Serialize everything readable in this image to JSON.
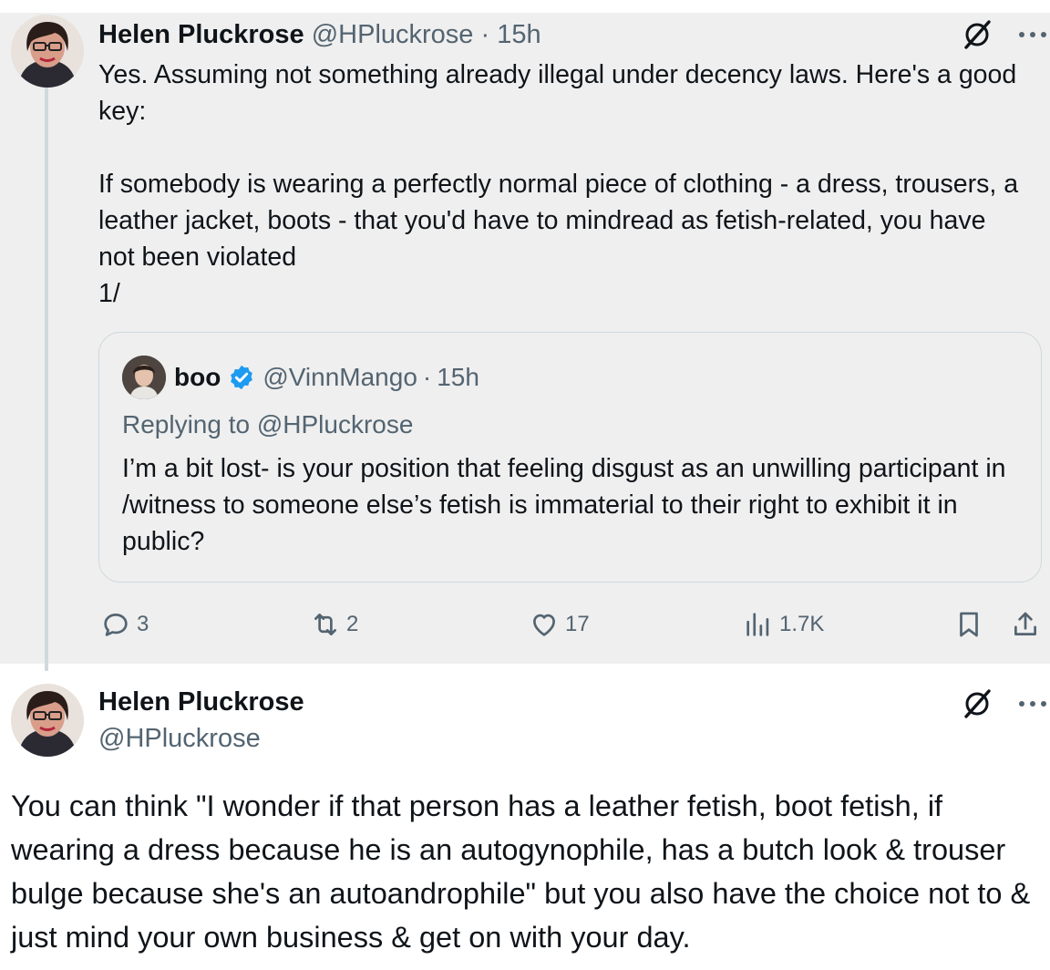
{
  "thread_tweet": {
    "author_name": "Helen Pluckrose",
    "author_handle": "@HPluckrose",
    "separator": "·",
    "time": "15h",
    "text": "Yes. Assuming not something already illegal under decency laws. Here's a good key:\n\nIf somebody is wearing a perfectly normal piece of clothing - a dress, trousers, a leather jacket, boots - that you'd have to mindread as fetish-related, you have not been violated\n1/",
    "quoted": {
      "author_name": "boo",
      "author_handle": "@VinnMango",
      "separator": "·",
      "time": "15h",
      "replying_to": "Replying to @HPluckrose",
      "text": "I’m a bit lost- is your position that feeling disgust as an unwilling participant in /witness to someone else’s fetish is immaterial to their right to exhibit it in public?"
    },
    "actions": {
      "replies": "3",
      "reposts": "2",
      "likes": "17",
      "views": "1.7K"
    }
  },
  "main_tweet": {
    "author_name": "Helen Pluckrose",
    "author_handle": "@HPluckrose",
    "text": "You can think \"I wonder if that person has a leather fetish, boot fetish, if wearing a dress because he is an autogynophile, has a butch look & trouser bulge because she's an autoandrophile\" but you also have the choice not to & just mind your own business & get on with your day."
  },
  "icons": {
    "grok": "grok-icon",
    "more": "more-icon",
    "verified": "verified-badge-icon",
    "reply": "reply-icon",
    "repost": "repost-icon",
    "like": "like-icon",
    "views": "views-icon",
    "bookmark": "bookmark-icon",
    "share": "share-icon"
  },
  "colors": {
    "text_primary": "#0f1419",
    "text_secondary": "#536471",
    "verified_blue": "#1d9bf0",
    "thread_background": "#efefef",
    "border": "#cfd9de"
  }
}
